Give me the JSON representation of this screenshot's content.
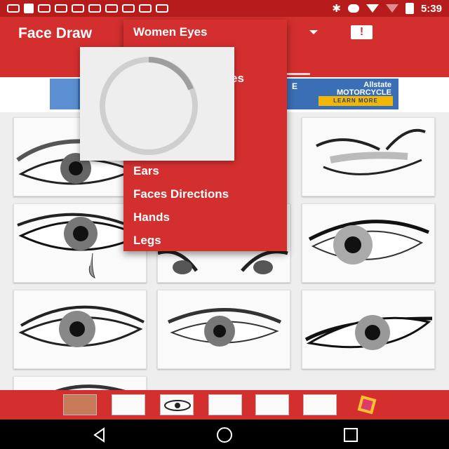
{
  "status_bar": {
    "time": "5:39",
    "icons": [
      "message-icon",
      "facebook-icon",
      "voicemail-icon",
      "voicemail-icon",
      "voicemail-icon",
      "voicemail-icon",
      "voicemail-icon",
      "voicemail-icon",
      "voicemail-icon",
      "voicemail-icon",
      "bluetooth-icon",
      "do-not-disturb-icon",
      "wifi-icon",
      "no-signal-icon",
      "battery-charging-icon"
    ]
  },
  "appbar": {
    "title": "Face Draw",
    "report_icon": "report-icon",
    "dropdown_icon": "arrow-drop-down-icon"
  },
  "ad": {
    "brand": "Allstate",
    "brand_sub": "MOTORCYCLE",
    "letters": "E",
    "cta": "LEARN MORE"
  },
  "menu": {
    "items": [
      "Women Eyes",
      "Ears",
      "Faces Directions",
      "Hands",
      "Legs"
    ],
    "partial_suffix": "es"
  },
  "progress": {
    "icon": "spinner-icon"
  },
  "bottom_strip": {
    "items": [
      "eyes-thumb",
      "hair-thumb",
      "eye-thumb",
      "figure-thumb",
      "face-thumb",
      "girl-thumb",
      "app-logo-icon"
    ]
  },
  "navbar": {
    "buttons": [
      "back-icon",
      "home-icon",
      "recents-icon"
    ]
  },
  "colors": {
    "primary": "#d32f2f",
    "status": "#b71c1c",
    "background": "#eeeeee"
  }
}
